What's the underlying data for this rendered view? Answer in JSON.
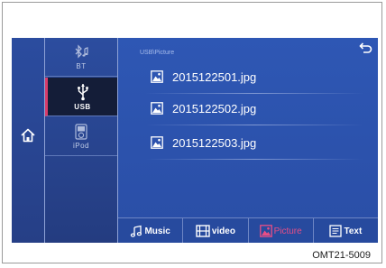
{
  "home": {
    "icon": "home-icon"
  },
  "sources": [
    {
      "label": "BT",
      "icon": "bluetooth-music-icon",
      "active": false
    },
    {
      "label": "USB",
      "icon": "usb-icon",
      "active": true
    },
    {
      "label": "iPod",
      "icon": "ipod-icon",
      "active": false
    }
  ],
  "browser": {
    "path": "USB\\Picture",
    "back_icon": "back-arrow-icon",
    "files": [
      {
        "name": "2015122501.jpg",
        "icon": "image-file-icon"
      },
      {
        "name": "2015122502.jpg",
        "icon": "image-file-icon"
      },
      {
        "name": "2015122503.jpg",
        "icon": "image-file-icon"
      }
    ]
  },
  "tabs": [
    {
      "label": "Music",
      "icon": "music-note-icon",
      "active": false
    },
    {
      "label": "video",
      "icon": "film-icon",
      "active": false
    },
    {
      "label": "Picture",
      "icon": "picture-icon",
      "active": true
    },
    {
      "label": "Text",
      "icon": "text-doc-icon",
      "active": false
    }
  ],
  "caption": "OMT21-5009",
  "colors": {
    "screen_bg": "#2a4a9a",
    "active_accent": "#e84e86",
    "active_source_bg": "#141d38"
  }
}
